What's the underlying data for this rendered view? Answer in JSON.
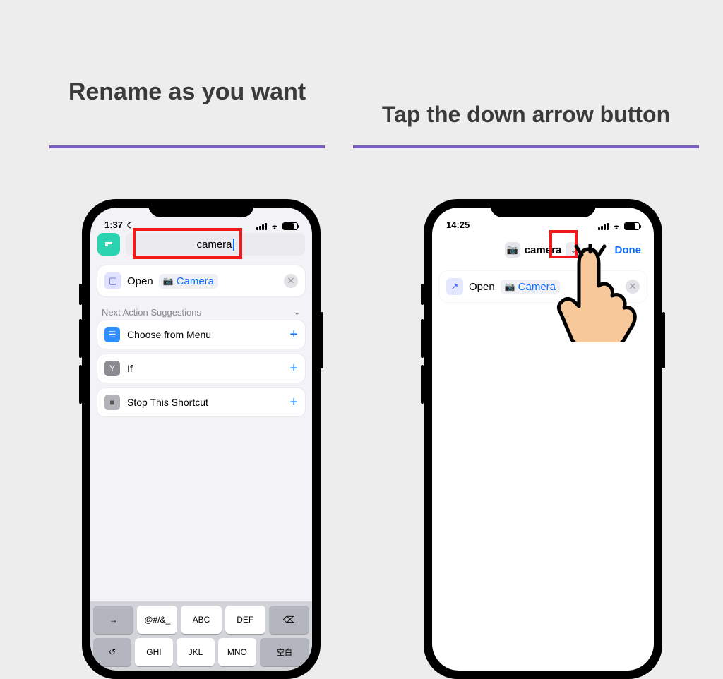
{
  "captions": {
    "left": "Rename as you want",
    "right": "Tap the down arrow button"
  },
  "colors": {
    "accent": "#7a5fbf",
    "highlight": "#f11a1a",
    "link": "#0b6cff"
  },
  "phone_left": {
    "status": {
      "time": "1:37",
      "dnd": "☾"
    },
    "shortcut_name": "camera",
    "action": {
      "label": "Open",
      "param": "Camera"
    },
    "suggestions_header": "Next Action Suggestions",
    "suggestions": [
      {
        "icon": "menu",
        "label": "Choose from Menu"
      },
      {
        "icon": "if",
        "label": "If"
      },
      {
        "icon": "stop",
        "label": "Stop This Shortcut"
      }
    ],
    "keyboard": {
      "row1": [
        "→",
        "@#/&_",
        "ABC",
        "DEF",
        "⌫"
      ],
      "row2": [
        "↺",
        "GHI",
        "JKL",
        "MNO",
        "空白"
      ]
    }
  },
  "phone_right": {
    "status": {
      "time": "14:25"
    },
    "title": "camera",
    "done_label": "Done",
    "action": {
      "label": "Open",
      "param": "Camera"
    }
  }
}
